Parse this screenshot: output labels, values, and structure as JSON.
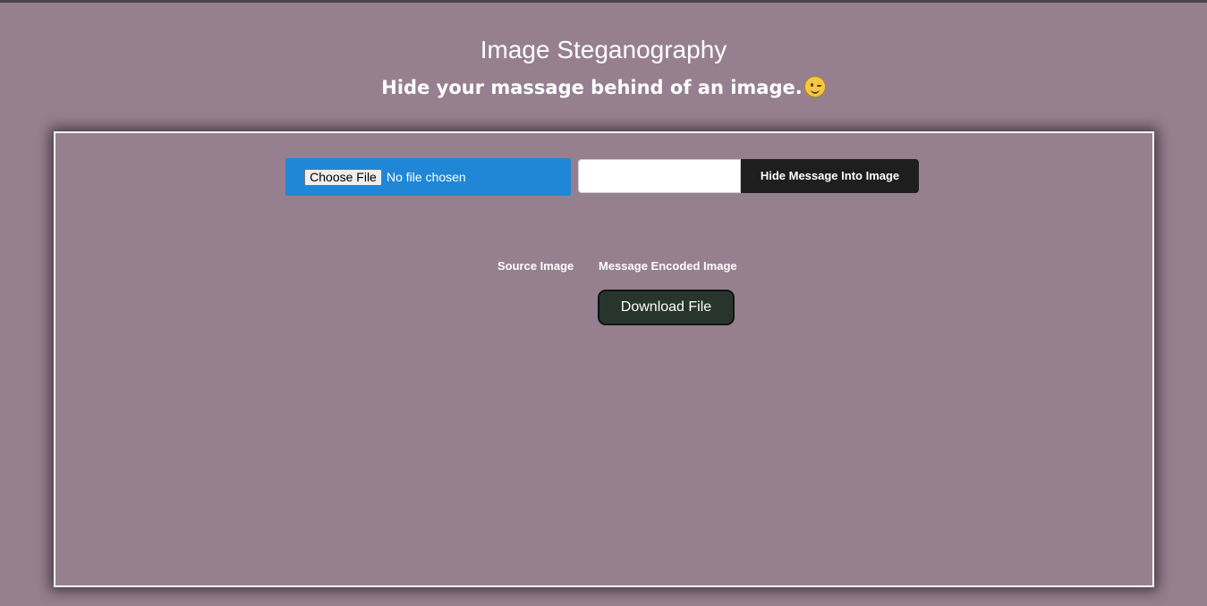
{
  "header": {
    "title": "Image Steganography",
    "subtitle": "Hide your massage behind of an image.",
    "subtitle_icon": "wink-emoji-icon"
  },
  "form": {
    "file_button_label": "Choose File",
    "file_status": "No file chosen",
    "message_input_value": "",
    "message_input_placeholder": "",
    "submit_label": "Hide Message Into Image"
  },
  "images": {
    "source_label": "Source Image",
    "encoded_label": "Message Encoded Image"
  },
  "download": {
    "label": "Download File"
  },
  "colors": {
    "background": "#96808f",
    "file_box": "#2086d6",
    "submit_button": "#1e1e1f",
    "download_button": "#27352d",
    "panel_border": "#ffffff"
  }
}
